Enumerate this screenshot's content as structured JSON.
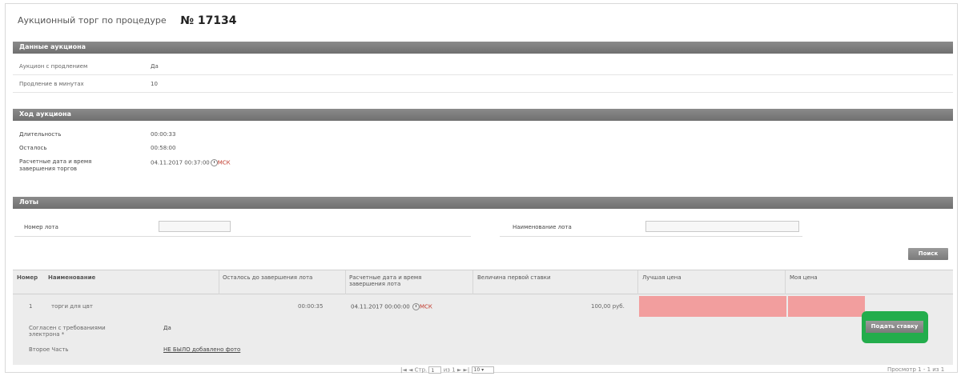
{
  "title": {
    "text": "Аукционный торг по процедуре",
    "number": "№ 17134"
  },
  "auction_data": {
    "header": "Данные аукциона",
    "rows": [
      {
        "label": "Аукцион с продлением",
        "value": "Да"
      },
      {
        "label": "Продление в минутах",
        "value": "10"
      }
    ]
  },
  "progress": {
    "header": "Ход аукциона",
    "duration_label": "Длительность",
    "duration_value": "00:00:33",
    "remaining_label": "Осталось",
    "remaining_value": "00:58:00",
    "end_label_line1": "Расчетные дата и время",
    "end_label_line2": "завершения торгов",
    "end_value": "04.11.2017 00:37:00",
    "end_tz": "МСК"
  },
  "lots": {
    "header": "Лоты",
    "lot_number_label": "Номер лота",
    "lot_number_value": "",
    "lot_name_label": "Наименование лота",
    "lot_name_value": "",
    "search_button": "Поиск"
  },
  "table": {
    "columns": [
      "Номер",
      "Наименование",
      "Осталось до завершения лота",
      "Расчетные дата и время завершения лота",
      "Величина первой ставки",
      "Лучшая цена",
      "Моя цена"
    ],
    "rows": [
      {
        "number": "1",
        "name": "торги для цвт",
        "remaining": "00:00:35",
        "end_datetime": "04.11.2017 00:00:00",
        "end_tz": "МСК",
        "first_bid": "100,00 руб.",
        "best_price": "",
        "my_price": "",
        "bid_button": "Подать ставку"
      }
    ],
    "details": [
      {
        "label": "Согласен с требованиями электрона *",
        "value": "Да"
      },
      {
        "label": "Второе Часть",
        "value": "НЕ БЫЛО добавлено фото"
      }
    ]
  },
  "pager": {
    "first": "|◄",
    "prev": "◄",
    "page_label": "Стр.",
    "page_value": "1",
    "of_label": "из 1",
    "next": "►",
    "last": "►|",
    "per_page": "10"
  },
  "view_info": "Просмотр 1 - 1 из 1",
  "colors": {
    "section_header": "#7b7b7b",
    "best_price_bg": "#f29e9e",
    "highlight_frame": "#23ad4c",
    "table_bg": "#ececec"
  }
}
